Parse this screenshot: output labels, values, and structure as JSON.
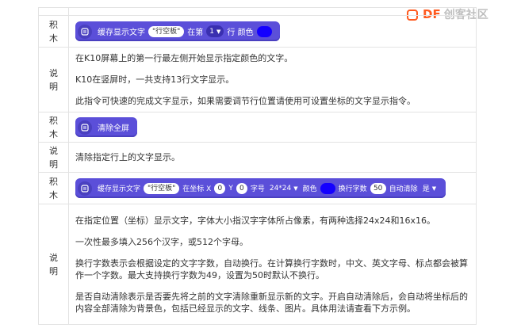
{
  "logo": {
    "brand": "DF",
    "suffix": "创客社区"
  },
  "rows": [
    {
      "type": "block",
      "label": [
        "积",
        "木"
      ],
      "block": {
        "text1": "缓存显示文字",
        "pill": "\"行空板\"",
        "text2": "在第",
        "dropdown": "1",
        "text3": "行 颜色",
        "color": "#1400ff"
      }
    },
    {
      "type": "desc",
      "label": [
        "说",
        "明"
      ],
      "lines": [
        "在K10屏幕上的第一行最左侧开始显示指定颜色的文字。",
        "K10在竖屏时，一共支持13行文字显示。",
        "此指令可快速的完成文字显示，如果需要调节行位置请使用可设置坐标的文字显示指令。"
      ]
    },
    {
      "type": "block",
      "label": [
        "积",
        "木"
      ],
      "block": {
        "text1": "清除全屏"
      }
    },
    {
      "type": "desc",
      "label": [
        "说",
        "明"
      ],
      "lines": [
        "清除指定行上的文字显示。"
      ]
    },
    {
      "type": "block",
      "label": [
        "积",
        "木"
      ],
      "block": {
        "text1": "缓存显示文字",
        "pill": "\"行空板\"",
        "text2": "在坐标 X",
        "x": "0",
        "text3": "Y",
        "y": "0",
        "text4": "字号",
        "size": "24*24",
        "text5": "颜色",
        "color": "#1400ff",
        "text6": "换行字数",
        "wrap": "50",
        "text7": "自动清除",
        "auto": "是"
      }
    },
    {
      "type": "desc",
      "label": [
        "说",
        "明"
      ],
      "lines": [
        "在指定位置（坐标）显示文字，字体大小指汉字字体所占像素，有两种选择24x24和16x16。",
        "一次性最多填入256个汉字，或512个字母。",
        "换行字数表示会根据设定的文字字数，自动换行。在计算换行字数时，中文、英文字母、标点都会被算作一个字数。最大支持换行字数为49，设置为50时默认不换行。",
        "是否自动清除表示是否要先将之前的文字清除重新显示新的文字。开启自动清除后，会自动将坐标后的内容全部清除为背景色，包括已经显示的文字、线条、图片。具体用法请查看下方示例。"
      ]
    }
  ]
}
